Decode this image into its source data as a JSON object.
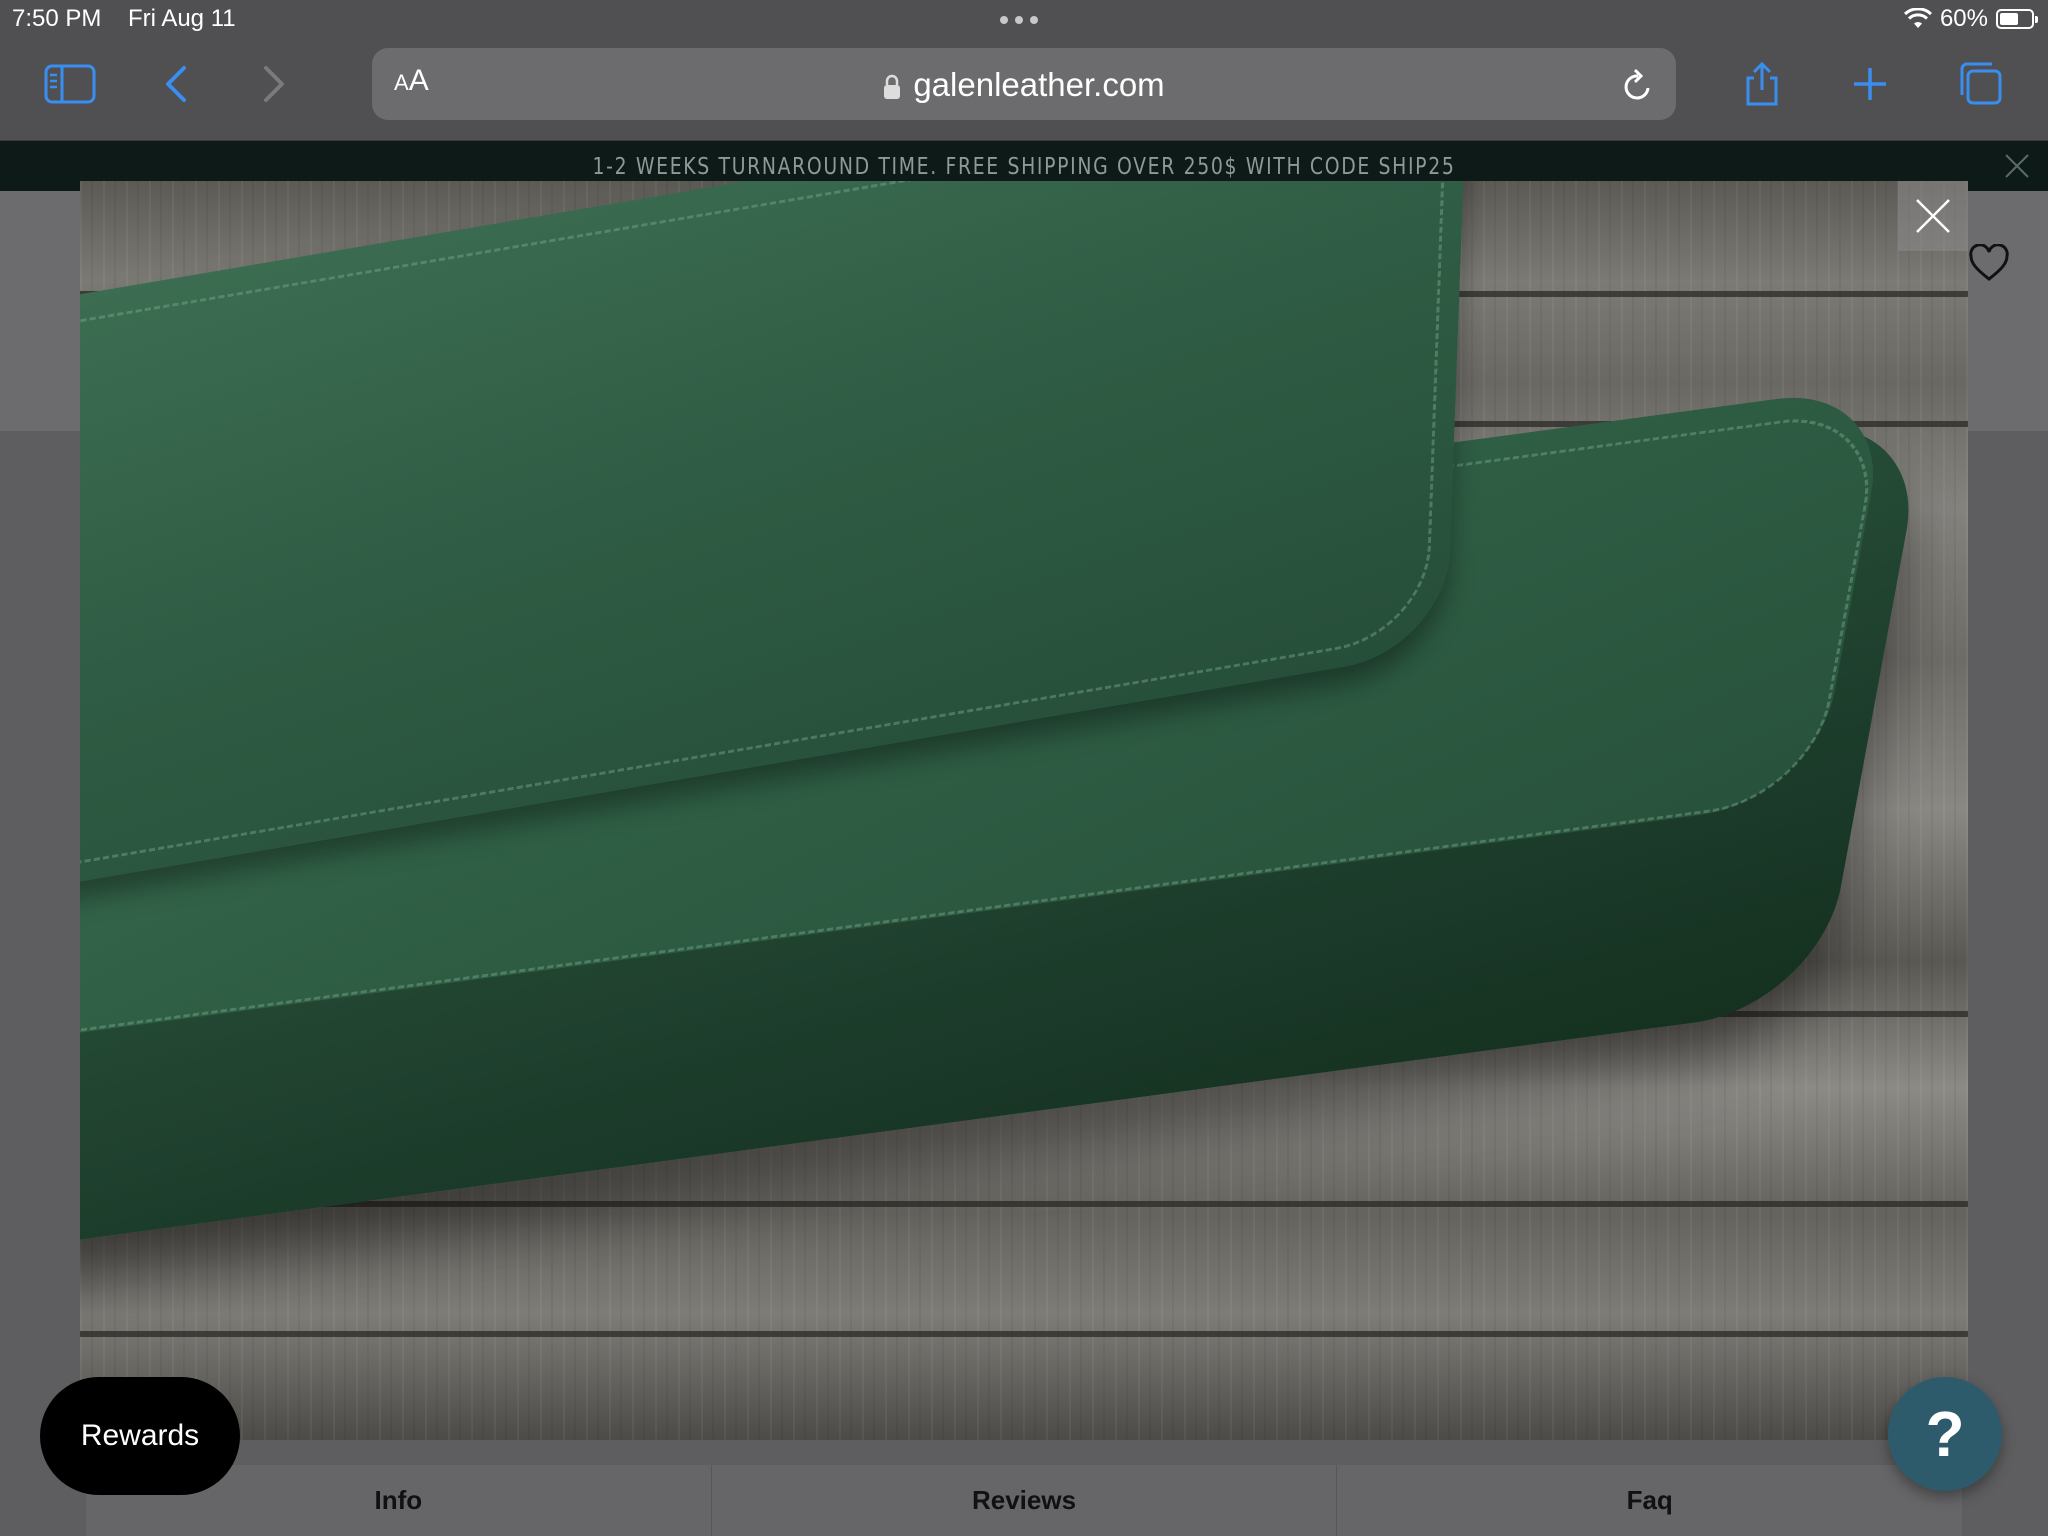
{
  "status_bar": {
    "time": "7:50 PM",
    "date": "Fri Aug 11",
    "battery": "60%",
    "battery_level": 0.6
  },
  "toolbar": {
    "text_size_small": "A",
    "text_size_large": "A",
    "url": "galenleather.com"
  },
  "promo": {
    "text": "1-2 WEEKS TURNAROUND TIME. FREE SHIPPING OVER 250$ WITH CODE SHIP25"
  },
  "tabs": [
    "Info",
    "Reviews",
    "Faq"
  ],
  "rewards": {
    "label": "Rewards"
  },
  "help": {
    "label": "?"
  },
  "colors": {
    "promo_bg": "#0d1a17",
    "help_bg": "#2e5b6c",
    "rewards_bg": "#000000",
    "leather": "#2f5c44"
  }
}
